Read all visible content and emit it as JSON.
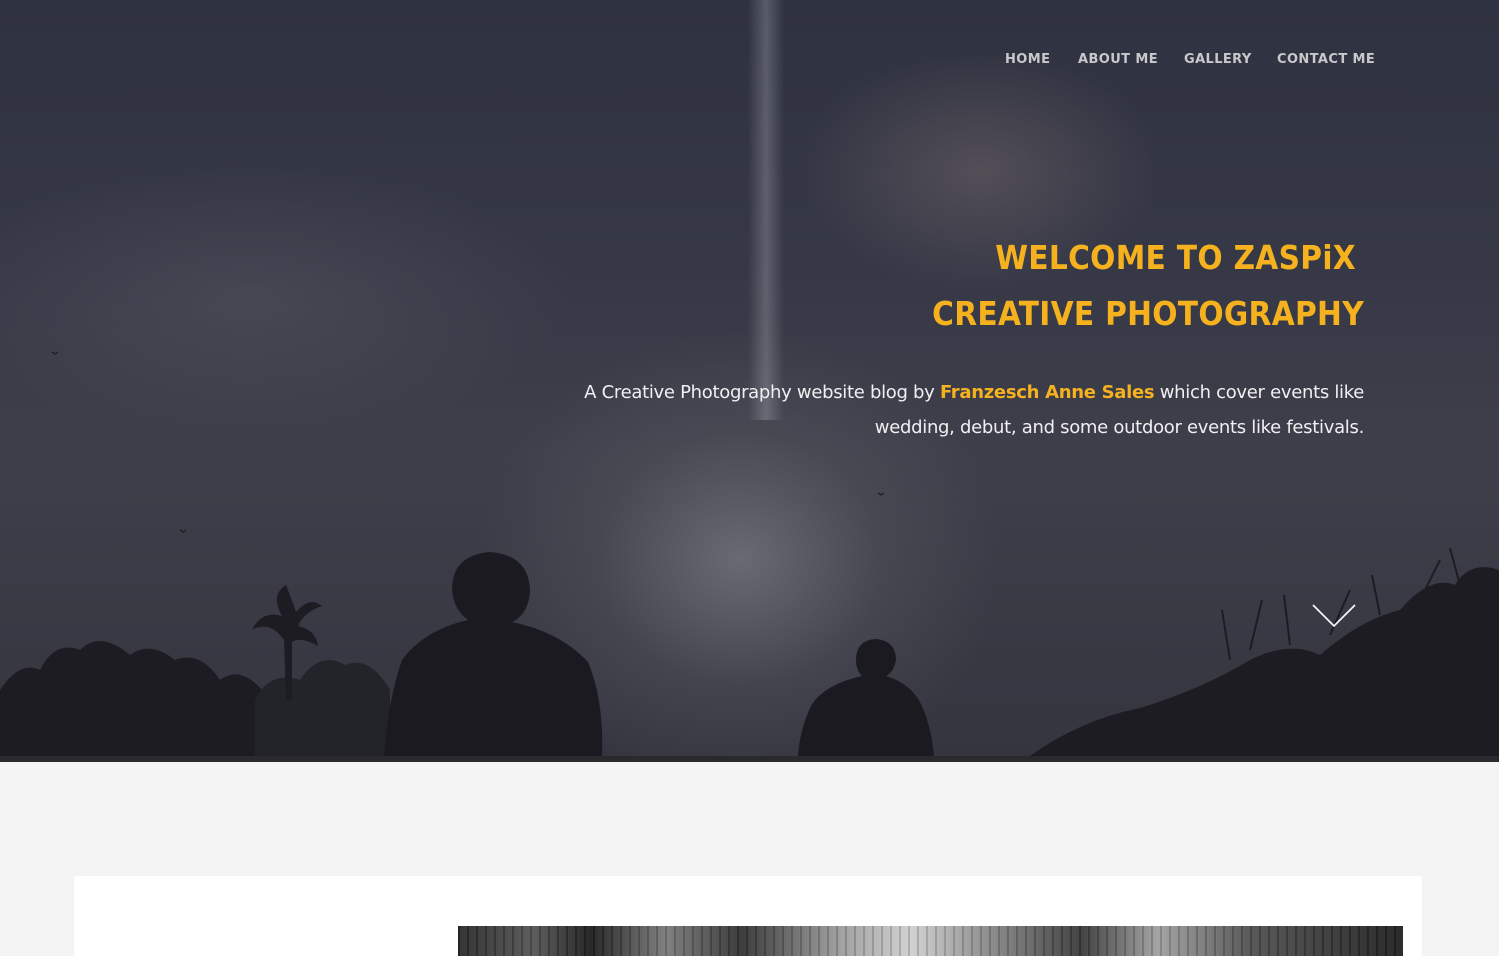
{
  "nav": {
    "items": [
      {
        "label": "HOME"
      },
      {
        "label": "ABOUT ME"
      },
      {
        "label": "GALLERY"
      },
      {
        "label": "CONTACT ME"
      }
    ]
  },
  "hero": {
    "title_line1": "WELCOME TO ZASPiX",
    "title_line2": "CREATIVE PHOTOGRAPHY",
    "text_before": "A Creative Photography website blog by ",
    "author": "Franzesch Anne Sales",
    "text_after": " which cover events like wedding, debut, and some outdoor events like festivals.",
    "scroll_icon": "chevron-down-icon"
  },
  "colors": {
    "accent": "#f5b21e",
    "nav_text": "#c9c9cc",
    "page_bg": "#f4f4f4"
  }
}
